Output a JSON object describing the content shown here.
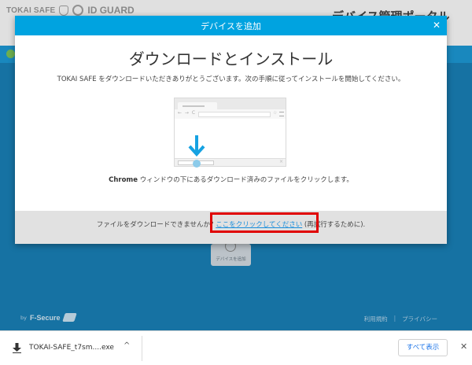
{
  "background": {
    "logo_tokai": "TOKAI SAFE",
    "logo_idguard": "ID GUARD",
    "page_title": "デバイス管理ポータル",
    "add_device_label": "デバイスを追加",
    "footer_by": "by",
    "footer_brand": "F-Secure",
    "footer_terms": "利用規約",
    "footer_sep": "|",
    "footer_privacy": "プライバシー"
  },
  "modal": {
    "title": "デバイスを追加",
    "close_label": "✕",
    "heading": "ダウンロードとインストール",
    "intro": "TOKAI SAFE をダウンロードいただきありがとうございます。次の手順に従ってインストールを開始してください。",
    "instruction_bold": "Chrome",
    "instruction_rest": " ウィンドウの下にあるダウンロード済みのファイルをクリックします。",
    "footer_prefix": "ファイルをダウンロードできませんか? ",
    "footer_link": "ここをクリックしてください",
    "footer_suffix": " (再試行するために)."
  },
  "illustration": {
    "nav_glyphs": "← → C",
    "star_glyph": "☆",
    "close_glyph": "×"
  },
  "download_bar": {
    "filename": "TOKAI-SAFE_t7sm....exe",
    "chevron": "^",
    "show_all": "すべて表示",
    "close": "✕"
  },
  "colors": {
    "modal_header": "#00a3e0",
    "background_main": "#1a82ba",
    "link": "#1a8fdc",
    "highlight": "#e00000"
  },
  "icons": [
    "shield-icon",
    "id-guard-icon",
    "check-icon",
    "plus-icon",
    "close-icon",
    "download-arrow-icon",
    "file-icon",
    "chevron-up-icon"
  ]
}
